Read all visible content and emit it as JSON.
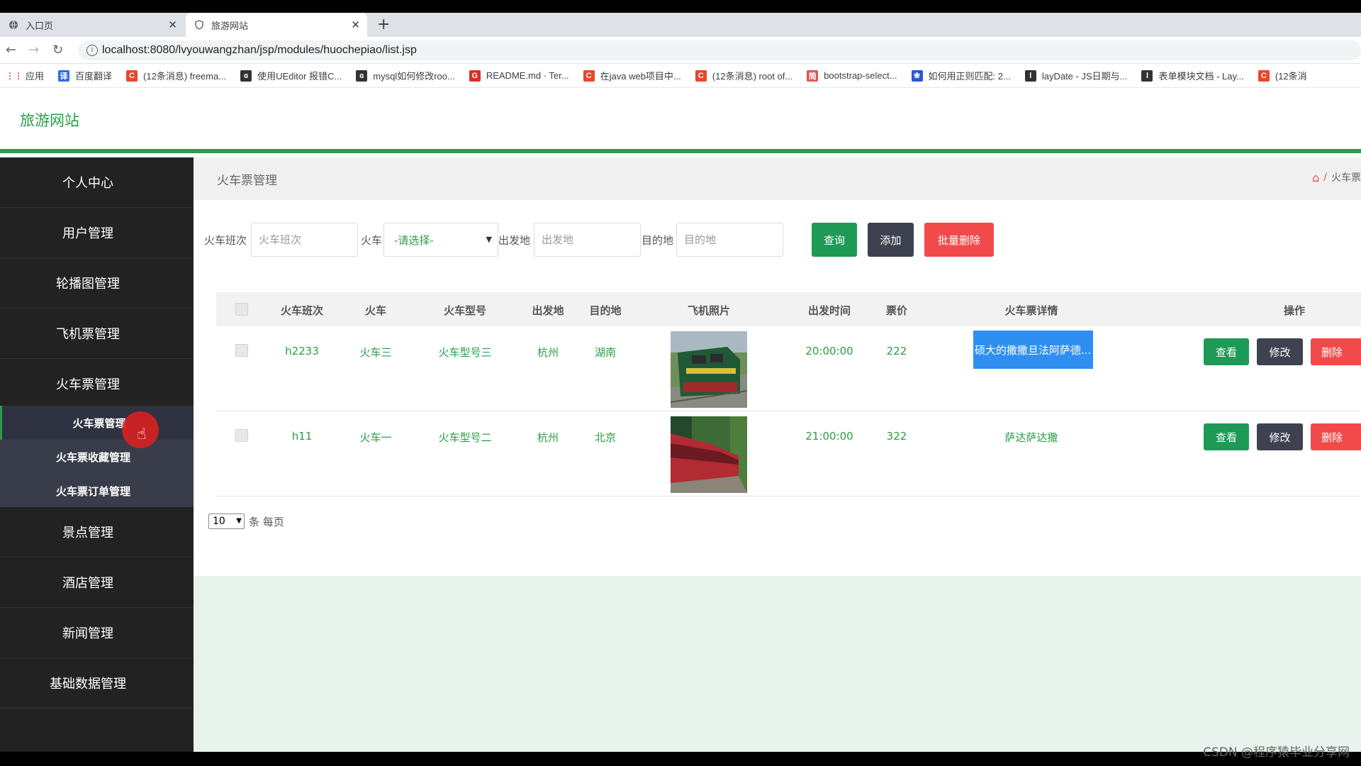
{
  "browser": {
    "tabs": [
      {
        "label": "入口页"
      },
      {
        "label": "旅游网站"
      }
    ],
    "url": "localhost:8080/lvyouwangzhan/jsp/modules/huochepiao/list.jsp",
    "bookmarks": [
      {
        "label": "应用",
        "color": "#5f6368",
        "glyph": "⋮⋮"
      },
      {
        "label": "百度翻译",
        "color": "#2b6de5",
        "glyph": "译"
      },
      {
        "label": "(12条消息) freema...",
        "color": "#e8472a",
        "glyph": "C"
      },
      {
        "label": "使用UEditor 报错C...",
        "color": "#333333",
        "glyph": "ɞ"
      },
      {
        "label": "mysql如何修改roo...",
        "color": "#333333",
        "glyph": "ɞ"
      },
      {
        "label": "README.md · Ter...",
        "color": "#d93025",
        "glyph": "G"
      },
      {
        "label": "在java web项目中...",
        "color": "#e8472a",
        "glyph": "C"
      },
      {
        "label": "(12条消息) root of...",
        "color": "#e8472a",
        "glyph": "C"
      },
      {
        "label": "bootstrap-select...",
        "color": "#e05555",
        "glyph": "简"
      },
      {
        "label": "如何用正则匹配: 2...",
        "color": "#2b55d8",
        "glyph": "❀"
      },
      {
        "label": "layDate - JS日期与...",
        "color": "#333333",
        "glyph": "l"
      },
      {
        "label": "表单模块文档 - Lay...",
        "color": "#333333",
        "glyph": "l"
      },
      {
        "label": "(12条消",
        "color": "#e8472a",
        "glyph": "C"
      }
    ]
  },
  "site": {
    "title": "旅游网站"
  },
  "sidebar": {
    "items": [
      {
        "label": "个人中心"
      },
      {
        "label": "用户管理"
      },
      {
        "label": "轮播图管理"
      },
      {
        "label": "飞机票管理"
      },
      {
        "label": "火车票管理"
      }
    ],
    "submenu": [
      {
        "label": "火车票管理"
      },
      {
        "label": "火车票收藏管理"
      },
      {
        "label": "火车票订单管理"
      }
    ],
    "items_after": [
      {
        "label": "景点管理"
      },
      {
        "label": "酒店管理"
      },
      {
        "label": "新闻管理"
      },
      {
        "label": "基础数据管理"
      }
    ]
  },
  "page": {
    "title": "火车票管理",
    "breadcrumb": {
      "sep": "/",
      "current": "火车票"
    }
  },
  "search": {
    "banci_label": "火车班次",
    "banci_placeholder": "火车班次",
    "train_label": "火车",
    "train_selected": "-请选择-",
    "from_label": "出发地",
    "from_placeholder": "出发地",
    "to_label": "目的地",
    "to_placeholder": "目的地",
    "search_btn": "查询",
    "add_btn": "添加",
    "batch_delete_btn": "批量删除"
  },
  "table": {
    "headers": {
      "banci": "火车班次",
      "train": "火车",
      "model": "火车型号",
      "from": "出发地",
      "to": "目的地",
      "photo": "飞机照片",
      "time": "出发时间",
      "price": "票价",
      "detail": "火车票详情",
      "ops": "操作"
    },
    "rows": [
      {
        "banci": "h2233",
        "train": "火车三",
        "model": "火车型号三",
        "from": "杭州",
        "to": "湖南",
        "time": "20:00:00",
        "price": "222",
        "detail": "硕大的撒撒旦法阿萨德...",
        "view": "查看",
        "edit": "修改",
        "del": "删除"
      },
      {
        "banci": "h11",
        "train": "火车一",
        "model": "火车型号二",
        "from": "杭州",
        "to": "北京",
        "time": "21:00:00",
        "price": "322",
        "detail": "萨达萨达撒",
        "view": "查看",
        "edit": "修改",
        "del": "删除"
      }
    ]
  },
  "pager": {
    "page_size": "10",
    "per_page_label": "条 每页"
  },
  "watermark": "CSDN @程序猿毕业分享网"
}
